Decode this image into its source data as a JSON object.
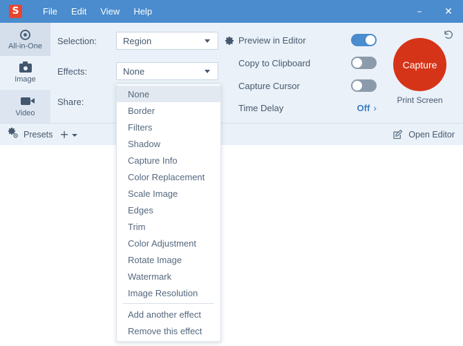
{
  "titlebar": {
    "logo_icon": "snagit-logo-icon",
    "logo_letter": "S",
    "menus": [
      "File",
      "Edit",
      "View",
      "Help"
    ],
    "minimize_glyph": "–",
    "close_glyph": "✕"
  },
  "sidebar": {
    "items": [
      {
        "label": "All-in-One",
        "icon": "all-in-one-icon",
        "selected": true
      },
      {
        "label": "Image",
        "icon": "camera-icon",
        "selected": false
      },
      {
        "label": "Video",
        "icon": "video-camera-icon",
        "selected": false
      }
    ]
  },
  "settings": {
    "selection": {
      "label": "Selection:",
      "value": "Region",
      "gear_icon": "gear-icon"
    },
    "effects": {
      "label": "Effects:",
      "value": "None"
    },
    "share": {
      "label": "Share:",
      "value": ""
    }
  },
  "options": {
    "preview_in_editor": {
      "label": "Preview in Editor",
      "state": "on"
    },
    "copy_to_clipboard": {
      "label": "Copy to Clipboard",
      "state": "off"
    },
    "capture_cursor": {
      "label": "Capture Cursor",
      "state": "off"
    },
    "time_delay": {
      "label": "Time Delay",
      "value": "Off",
      "chevron": "›"
    }
  },
  "capture": {
    "button_label": "Capture",
    "shortcut_label": "Print Screen",
    "reset_icon": "undo-reset-icon"
  },
  "bottombar": {
    "presets_label": "Presets",
    "presets_icon": "gear-icon",
    "add_preset_glyph": "+",
    "open_editor_label": "Open Editor",
    "open_editor_icon": "edit-pencil-icon"
  },
  "effects_menu": {
    "items": [
      {
        "label": "None",
        "highlighted": true
      },
      {
        "label": "Border",
        "highlighted": false
      },
      {
        "label": "Filters",
        "highlighted": false
      },
      {
        "label": "Shadow",
        "highlighted": false
      },
      {
        "label": "Capture Info",
        "highlighted": false
      },
      {
        "label": "Color Replacement",
        "highlighted": false
      },
      {
        "label": "Scale Image",
        "highlighted": false
      },
      {
        "label": "Edges",
        "highlighted": false
      },
      {
        "label": "Trim",
        "highlighted": false
      },
      {
        "label": "Color Adjustment",
        "highlighted": false
      },
      {
        "label": "Rotate Image",
        "highlighted": false
      },
      {
        "label": "Watermark",
        "highlighted": false
      },
      {
        "label": "Image Resolution",
        "highlighted": false
      }
    ],
    "actions": [
      {
        "label": "Add another effect"
      },
      {
        "label": "Remove this effect"
      }
    ]
  },
  "colors": {
    "titlebar": "#4a8ccd",
    "panel": "#eaf1f8",
    "accent": "#3a7fc1",
    "capture_red": "#d63418",
    "logo_red": "#e8462c",
    "text": "#46586e"
  }
}
